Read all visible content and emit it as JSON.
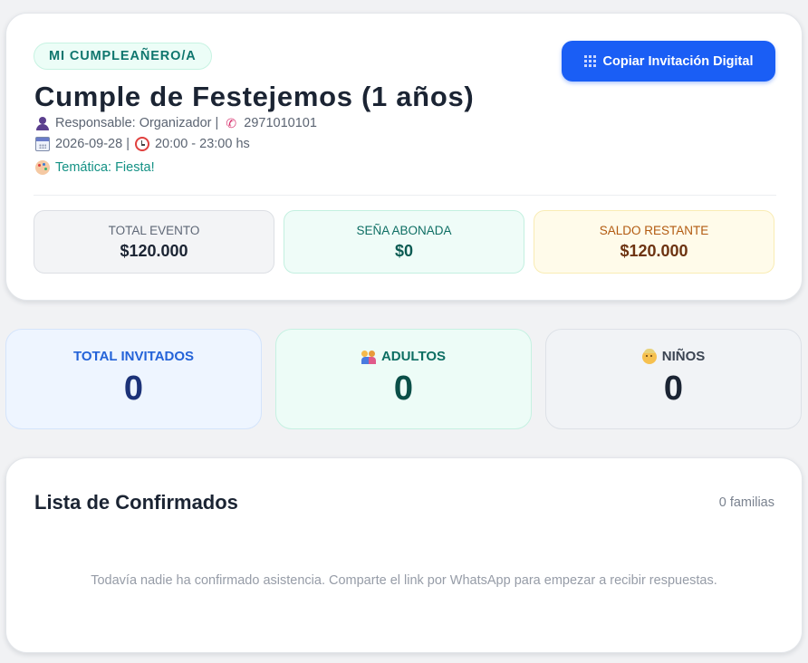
{
  "header": {
    "badge": "MI CUMPLEAÑERO/A",
    "copy_button_label": "Copiar Invitación Digital",
    "copy_button_icon": "building-icon",
    "title": "Cumple de Festejemos (1 años)",
    "responsable": "Responsable: Organizador |",
    "phone": "2971010101",
    "date": "2026-09-28 |",
    "time": "20:00 - 23:00 hs",
    "tematica": "Temática: Fiesta!"
  },
  "money": {
    "total": {
      "label": "TOTAL EVENTO",
      "value": "$120.000"
    },
    "sena": {
      "label": "SEÑA ABONADA",
      "value": "$0"
    },
    "saldo": {
      "label": "SALDO RESTANTE",
      "value": "$120.000"
    }
  },
  "stats": {
    "total": {
      "label": "TOTAL INVITADOS",
      "value": "0"
    },
    "adults": {
      "label": "ADULTOS",
      "value": "0"
    },
    "kids": {
      "label": "NIÑOS",
      "value": "0"
    }
  },
  "list": {
    "title": "Lista de Confirmados",
    "count": "0 familias",
    "empty_message": "Todavía nadie ha confirmado asistencia. Comparte el link por WhatsApp para empezar a recibir respuestas."
  },
  "colors": {
    "accent": "#1a5ef5",
    "badge_text": "#0f766e",
    "background": "#f1f2f4"
  }
}
